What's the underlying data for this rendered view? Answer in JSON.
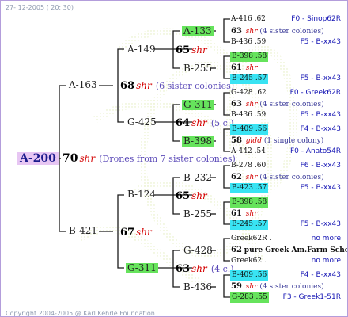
{
  "header": {
    "date": "27- 12-2005 ( 20: 30)"
  },
  "footer": {
    "copyright": "Copyright 2004-2005 @ Karl Kehrle Foundation."
  },
  "root": {
    "label": "A-200"
  },
  "gen1": {
    "num": "70",
    "shr": "shr",
    "note": "(Drones from 7 sister colonies)"
  },
  "gen2": {
    "top": "A-163",
    "bottom": "B-421"
  },
  "gen3": {
    "top": {
      "num": "68",
      "shr": "shr",
      "note": "(6 sister colonies)"
    },
    "bottom": {
      "num": "67",
      "shr": "shr"
    }
  },
  "gen4": {
    "a": "A-149",
    "b": "G-425",
    "c": "B-124",
    "d": "G-311"
  },
  "gen5": {
    "a": {
      "num": "65",
      "shr": "shr"
    },
    "b": {
      "num": "64",
      "shr": "shr",
      "note": "(5 c.)"
    },
    "c": {
      "num": "65",
      "shr": "shr"
    },
    "d": {
      "num": "63",
      "shr": "shr",
      "note": "(4 c.)"
    }
  },
  "gen6": {
    "a": "A-133",
    "b": "B-255",
    "c": "G-311",
    "d": "B-398",
    "e": "B-232",
    "f": "B-255",
    "g": "G-428",
    "h": "B-436"
  },
  "gen7": [
    {
      "id": "A-416",
      "val": ".62"
    },
    {
      "num": "63",
      "shr": "shr",
      "note": "(4 sister colonies)"
    },
    {
      "id": "B-436",
      "val": ".59"
    },
    {
      "id": "B-398",
      "val": ".58"
    },
    {
      "num": "61",
      "shr": "shr"
    },
    {
      "id": "B-245",
      "val": ".57"
    },
    {
      "id": "G-428",
      "val": ".62"
    },
    {
      "num": "63",
      "shr": "shr",
      "note": "(4 sister colonies)"
    },
    {
      "id": "B-436",
      "val": ".59"
    },
    {
      "id": "B-409",
      "val": ".56"
    },
    {
      "num": "58",
      "shr": "gldd",
      "note": "(1 single colony)"
    },
    {
      "id": "A-442",
      "val": ".54"
    },
    {
      "id": "B-278",
      "val": ".60"
    },
    {
      "num": "62",
      "shr": "shr",
      "note": "(4 sister colonies)"
    },
    {
      "id": "B-423",
      "val": ".57"
    },
    {
      "id": "B-398",
      "val": ".58"
    },
    {
      "num": "61",
      "shr": "shr"
    },
    {
      "id": "B-245",
      "val": ".57"
    },
    {
      "id": "Greek62R",
      "val": "."
    },
    {
      "num": "62",
      "name": "pure Greek Am.Farm School"
    },
    {
      "id": "Greek62",
      "val": "."
    },
    {
      "id": "B-409",
      "val": ".56"
    },
    {
      "num": "59",
      "shr": "shr",
      "note": "(4 sister colonies)"
    },
    {
      "id": "G-283",
      "val": ".55"
    }
  ],
  "right": [
    "F0 - Sinop62R",
    "F5 - B-xx43",
    "F5 - B-xx43",
    "F0 - Greek62R",
    "F5 - B-xx43",
    "F4 - B-xx43",
    "F0 - Anato54R",
    "F6 - B-xx43",
    "F5 - B-xx43",
    "F5 - B-xx43",
    "no more",
    "no more",
    "F4 - B-xx43",
    "F3 - Greek1-51R"
  ],
  "colors": {
    "line": "#1a1a1a",
    "highlight_green": "#66e35c",
    "highlight_cyan": "#39e3f3",
    "root_bg": "#e7c6f3",
    "shr": "#d40000",
    "note": "#5b4ab8",
    "right_text": "#1414b4"
  }
}
